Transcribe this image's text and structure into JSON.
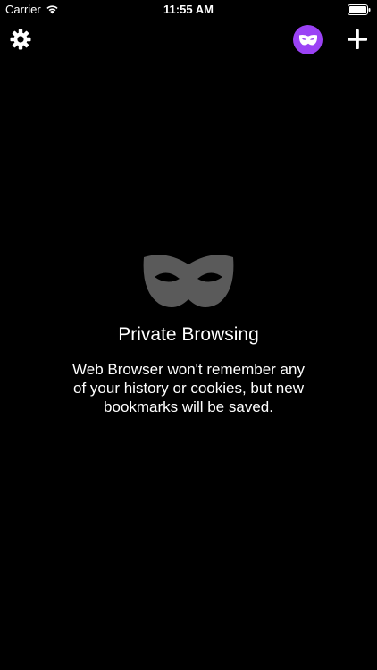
{
  "status_bar": {
    "carrier": "Carrier",
    "time": "11:55 AM"
  },
  "toolbar": {
    "settings_icon": "gear-icon",
    "private_mode_icon": "mask-icon",
    "add_tab_icon": "plus-icon",
    "private_mode_active": true
  },
  "private_panel": {
    "icon": "mask-icon",
    "title": "Private Browsing",
    "description": "Web Browser won't remember any of your history or cookies, but new bookmarks will be saved."
  },
  "colors": {
    "background": "#000000",
    "text": "#ffffff",
    "accent": "#9b42f5",
    "hero_icon": "#5a5a5a"
  }
}
